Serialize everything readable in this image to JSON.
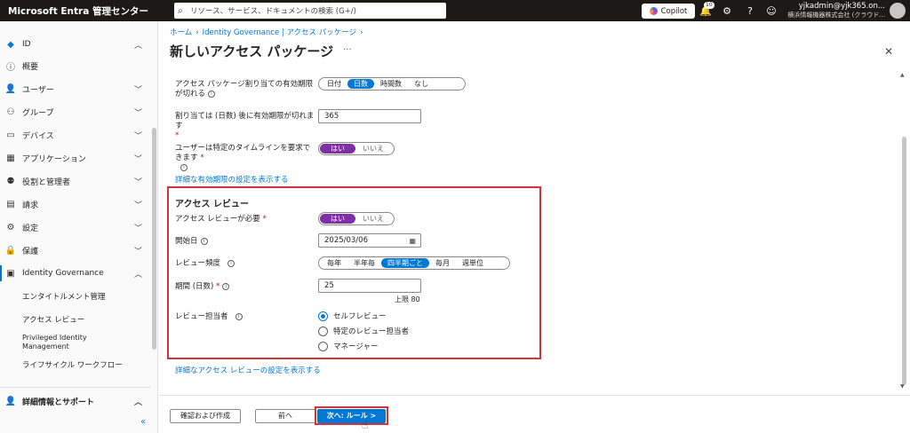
{
  "topbar": {
    "brand": "Microsoft Entra 管理センター",
    "search_placeholder": "リソース、サービス、ドキュメントの検索 (G+/)",
    "copilot_label": "Copilot",
    "notification_count": "10",
    "account_name": "yjkadmin@yjk365.on...",
    "account_org": "横浜情報機器株式会社 (クラウド..."
  },
  "sidebar": {
    "items": [
      {
        "label": "ID",
        "icon": "diamond-icon"
      },
      {
        "label": "概要",
        "icon": "info-icon"
      },
      {
        "label": "ユーザー",
        "icon": "person-icon"
      },
      {
        "label": "グループ",
        "icon": "group-icon"
      },
      {
        "label": "デバイス",
        "icon": "device-icon"
      },
      {
        "label": "アプリケーション",
        "icon": "grid-icon"
      },
      {
        "label": "役割と管理者",
        "icon": "role-icon"
      },
      {
        "label": "請求",
        "icon": "billing-icon"
      },
      {
        "label": "設定",
        "icon": "settings-icon"
      },
      {
        "label": "保護",
        "icon": "lock-icon"
      },
      {
        "label": "Identity Governance",
        "icon": "governance-icon"
      }
    ],
    "sub_items": [
      "エンタイトルメント管理",
      "アクセス レビュー",
      "Privileged Identity Management",
      "ライフサイクル ワークフロー"
    ],
    "help_label": "詳細情報とサポート",
    "collapse_glyph": "«"
  },
  "breadcrumb": {
    "home": "ホーム",
    "current": "Identity Governance | アクセス パッケージ"
  },
  "page": {
    "title": "新しいアクセス パッケージ",
    "ellipsis": "···"
  },
  "form": {
    "expire_label": "アクセス パッケージ割り当ての有効期限が切れる",
    "expire_options": [
      "日付",
      "日数",
      "時間数",
      "なし"
    ],
    "expire_selected": "日数",
    "days_label": "割り当ては (日数) 後に有効期限が切れます",
    "days_value": "365",
    "timeline_label": "ユーザーは特定のタイムラインを要求できます",
    "timeline_yes": "はい",
    "timeline_no": "いいえ",
    "expire_link": "詳細な有効期限の設定を表示する"
  },
  "review": {
    "section_title": "アクセス レビュー",
    "required_label": "アクセス レビューが必要",
    "required_yes": "はい",
    "required_no": "いいえ",
    "start_label": "開始日",
    "start_value": "2025/03/06",
    "freq_label": "レビュー頻度",
    "freq_options": [
      "毎年",
      "半年毎",
      "四半期ごと",
      "毎月",
      "週単位"
    ],
    "freq_selected": "四半期ごと",
    "duration_label": "期間 (日数)",
    "duration_value": "25",
    "duration_limit": "上限 80",
    "reviewer_label": "レビュー担当者",
    "reviewer_options": [
      "セルフレビュー",
      "特定のレビュー担当者",
      "マネージャー"
    ],
    "reviewer_selected": "セルフレビュー",
    "review_link": "詳細なアクセス レビューの設定を表示する"
  },
  "footer": {
    "review_create": "確認および作成",
    "prev": "前へ",
    "next": "次へ: ルール >"
  },
  "colors": {
    "accent": "#0078d4",
    "toggle_on": "#7f2fa6",
    "highlight": "#d13438"
  }
}
